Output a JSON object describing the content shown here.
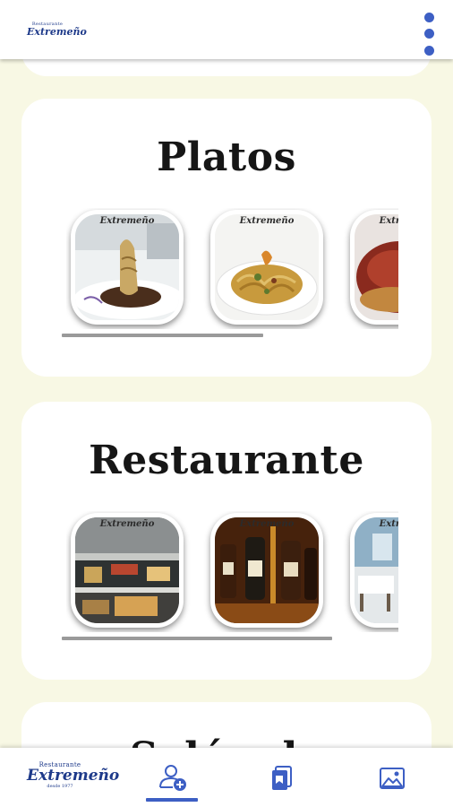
{
  "header": {
    "logo": {
      "small": "Restaurante",
      "name": "Extremeño",
      "tagline": "desde 1977"
    },
    "menu_icon": "more-vertical-icon"
  },
  "sections": [
    {
      "title": "Platos",
      "items": [
        {
          "image": "dish-artichoke-photo",
          "watermark": "Extremeño"
        },
        {
          "image": "dish-pasta-photo",
          "watermark": "Extremeño"
        },
        {
          "image": "dish-meat-photo",
          "watermark": "Extremeño"
        }
      ],
      "scroll_position": 0.0
    },
    {
      "title": "Restaurante",
      "items": [
        {
          "image": "restaurant-display-case-photo",
          "watermark": "Extremeño"
        },
        {
          "image": "restaurant-wine-bottles-photo",
          "watermark": "Extremeño"
        },
        {
          "image": "restaurant-dining-room-photo",
          "watermark": "Extremeño"
        }
      ],
      "scroll_position": 0.0
    },
    {
      "title": "Salón de"
    }
  ],
  "bottom_nav": {
    "logo": {
      "small": "Restaurante",
      "name": "Extremeño",
      "tagline": "desde 1977"
    },
    "items": [
      {
        "icon": "user-add-icon",
        "active": true
      },
      {
        "icon": "menu-book-icon",
        "active": false
      },
      {
        "icon": "image-gallery-icon",
        "active": false
      }
    ]
  },
  "colors": {
    "accent": "#3d5fc4",
    "background": "#f8f8e4",
    "logo": "#1e3a8a"
  }
}
